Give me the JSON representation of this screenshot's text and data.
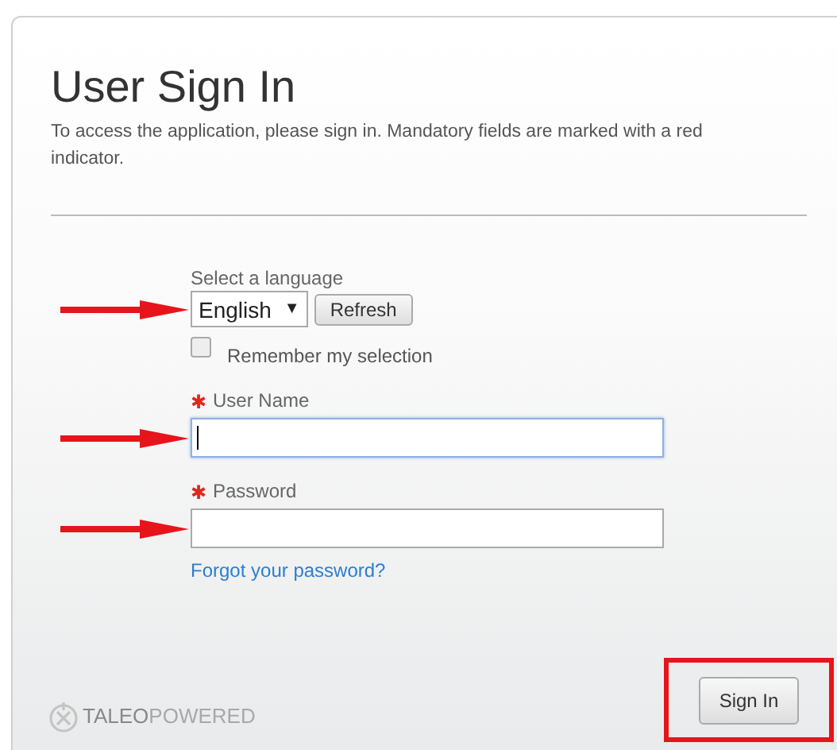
{
  "title": "User Sign In",
  "intro": "To access the application, please sign in. Mandatory fields are marked with a red indicator.",
  "language": {
    "label": "Select a language",
    "value": "English",
    "caret": "▼",
    "refresh": "Refresh",
    "annotated": true
  },
  "remember": {
    "label": "Remember my selection",
    "checked": false
  },
  "fields": [
    {
      "label": "User Name",
      "required": true,
      "focused": true,
      "annotated": true
    },
    {
      "label": "Password",
      "required": true,
      "focused": false,
      "annotated": true
    }
  ],
  "required_mark": "✱",
  "forgot_link": "Forgot your password?",
  "logo": {
    "brand": "TALEO",
    "suffix": "POWERED"
  },
  "sign_in": {
    "label": "Sign In",
    "highlighted": true
  }
}
